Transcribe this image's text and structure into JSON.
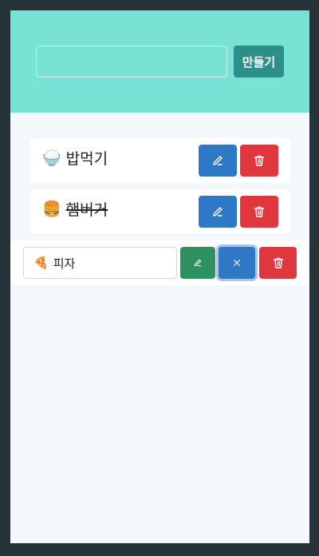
{
  "header": {
    "input_value": "",
    "create_label": "만들기"
  },
  "todos": [
    {
      "emoji": "🍚",
      "text": "밥먹기",
      "done": false
    },
    {
      "emoji": "🍔",
      "text": "햄버거",
      "done": true
    }
  ],
  "editing": {
    "emoji": "🍕",
    "text": "피자"
  },
  "icons": {
    "edit": "pencil-icon",
    "delete": "trash-icon",
    "cancel": "close-icon"
  },
  "colors": {
    "header_bg": "#78e3d4",
    "create_button": "#2c8f88",
    "edit_button": "#2f78c5",
    "delete_button": "#e0363e",
    "save_button": "#2f9160"
  }
}
